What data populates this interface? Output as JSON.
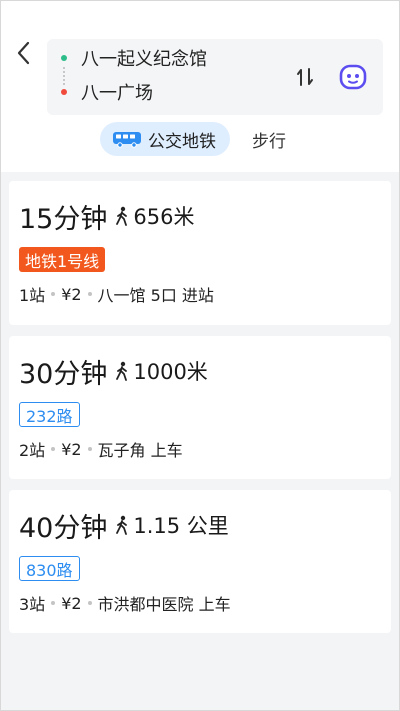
{
  "route": {
    "origin": "八一起义纪念馆",
    "destination": "八一广场",
    "origin_color": "#2dbd8a",
    "destination_color": "#f04a3c"
  },
  "tabs": [
    {
      "label": "公交地铁",
      "icon": "bus-icon",
      "active": true
    },
    {
      "label": "步行",
      "active": false
    }
  ],
  "routes": [
    {
      "duration": "15分钟",
      "walk": "656米",
      "line": "地铁1号线",
      "line_type": "metro",
      "stops": "1站",
      "price": "¥2",
      "station": "八一馆 5口 进站"
    },
    {
      "duration": "30分钟",
      "walk": "1000米",
      "line": "232路",
      "line_type": "bus",
      "stops": "2站",
      "price": "¥2",
      "station": "瓦子角 上车"
    },
    {
      "duration": "40分钟",
      "walk": "1.15 公里",
      "line": "830路",
      "line_type": "bus",
      "stops": "3站",
      "price": "¥2",
      "station": "市洪都中医院 上车"
    }
  ],
  "colors": {
    "accent": "#2d8df0",
    "metro": "#f2581d",
    "assistant": "#5b4df0",
    "tab_active_bg": "#dfeeff"
  }
}
